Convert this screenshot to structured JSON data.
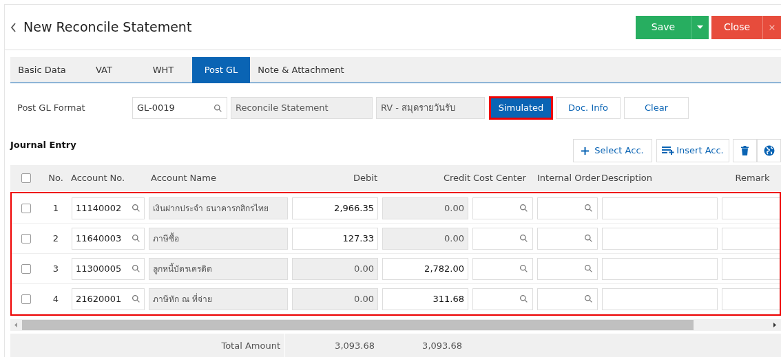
{
  "header": {
    "title": "New Reconcile Statement",
    "buttons": [
      {
        "kind": "save",
        "label": "Save"
      },
      {
        "kind": "close",
        "label": "Close",
        "close_glyph": "×"
      }
    ]
  },
  "tabs": [
    {
      "label": "Basic Data",
      "selected": false
    },
    {
      "label": "VAT",
      "selected": false
    },
    {
      "label": "WHT",
      "selected": false
    },
    {
      "label": "Post GL",
      "selected": true
    },
    {
      "label": "Note & Attachment",
      "selected": false
    }
  ],
  "post_gl_format": {
    "label": "Post GL Format",
    "code": "GL-0019",
    "name": "Reconcile Statement",
    "journal": "RV - สมุดรายวันรับ"
  },
  "actions": [
    {
      "label": "Simulated",
      "selected": true,
      "highlighted": true
    },
    {
      "label": "Doc. Info",
      "selected": false,
      "highlighted": false
    },
    {
      "label": "Clear",
      "selected": false,
      "highlighted": false
    }
  ],
  "journal_entry": {
    "title": "Journal Entry",
    "toolbar": [
      {
        "kind": "select",
        "label": "Select Acc."
      },
      {
        "kind": "insert",
        "label": "Insert Acc."
      },
      {
        "kind": "delete"
      },
      {
        "kind": "globe"
      }
    ]
  },
  "table": {
    "columns": [
      "No.",
      "Account No.",
      "Account Name",
      "Debit",
      "Credit",
      "Cost Center",
      "Internal Order",
      "Description",
      "Remark"
    ],
    "rows_highlighted": true,
    "all_checked": false,
    "rows": [
      {
        "checked": false,
        "no": "1",
        "account_no": "11140002",
        "account_name": "เงินฝากประจำ ธนาคารกสิกรไทย",
        "debit": {
          "value": "2,966.35",
          "disabled": false
        },
        "credit": {
          "value": "0.00",
          "disabled": true
        }
      },
      {
        "checked": false,
        "no": "2",
        "account_no": "11640003",
        "account_name": "ภาษีซื้อ",
        "debit": {
          "value": "127.33",
          "disabled": false
        },
        "credit": {
          "value": "0.00",
          "disabled": true
        }
      },
      {
        "checked": false,
        "no": "3",
        "account_no": "11300005",
        "account_name": "ลูกหนี้บัตรเครดิต",
        "debit": {
          "value": "0.00",
          "disabled": true
        },
        "credit": {
          "value": "2,782.00",
          "disabled": false
        }
      },
      {
        "checked": false,
        "no": "4",
        "account_no": "21620001",
        "account_name": "ภาษีหัก ณ ที่จ่าย",
        "debit": {
          "value": "0.00",
          "disabled": true
        },
        "credit": {
          "value": "311.68",
          "disabled": false
        }
      }
    ],
    "total": {
      "label": "Total Amount",
      "debit": "3,093.68",
      "credit": "3,093.68"
    }
  }
}
